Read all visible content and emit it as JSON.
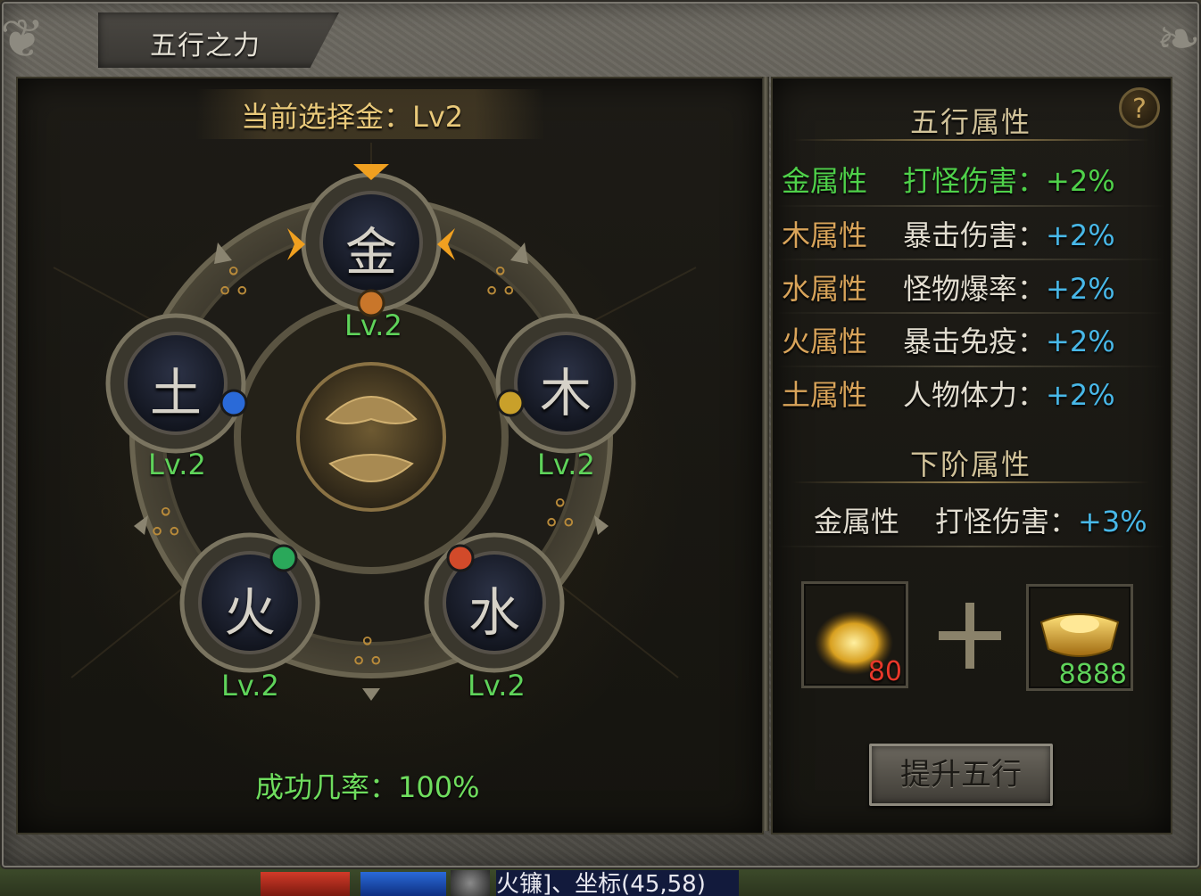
{
  "window": {
    "title": "五行之力"
  },
  "selection": {
    "text": "当前选择金：Lv2"
  },
  "elements": [
    {
      "name": "金",
      "level": "Lv.2"
    },
    {
      "name": "木",
      "level": "Lv.2"
    },
    {
      "name": "水",
      "level": "Lv.2"
    },
    {
      "name": "火",
      "level": "Lv.2"
    },
    {
      "name": "土",
      "level": "Lv.2"
    }
  ],
  "success_rate": "成功几率：100%",
  "attributes": {
    "title": "五行属性",
    "help": "?",
    "rows": [
      {
        "element": "金属性",
        "stat": "打怪伤害：",
        "value": "+2%",
        "color": "#4fd14a"
      },
      {
        "element": "木属性",
        "stat": "暴击伤害：",
        "value": "+2%",
        "color": "#d9a45a"
      },
      {
        "element": "水属性",
        "stat": "怪物爆率：",
        "value": "+2%",
        "color": "#d9a45a"
      },
      {
        "element": "火属性",
        "stat": "暴击免疫：",
        "value": "+2%",
        "color": "#d9a45a"
      },
      {
        "element": "土属性",
        "stat": "人物体力：",
        "value": "+2%",
        "color": "#d9a45a"
      }
    ]
  },
  "next_tier": {
    "title": "下阶属性",
    "element": "金属性",
    "stat": "打怪伤害：",
    "value": "+3%"
  },
  "cost": {
    "item1": {
      "icon": "gold-dust-icon",
      "count": "80",
      "count_color": "#e8382a"
    },
    "item2": {
      "icon": "gold-ingot-icon",
      "count": "8888",
      "count_color": "#5fd35a"
    }
  },
  "upgrade_button": "提升五行",
  "hud": {
    "location": "火镰]、坐标(45,58)"
  }
}
